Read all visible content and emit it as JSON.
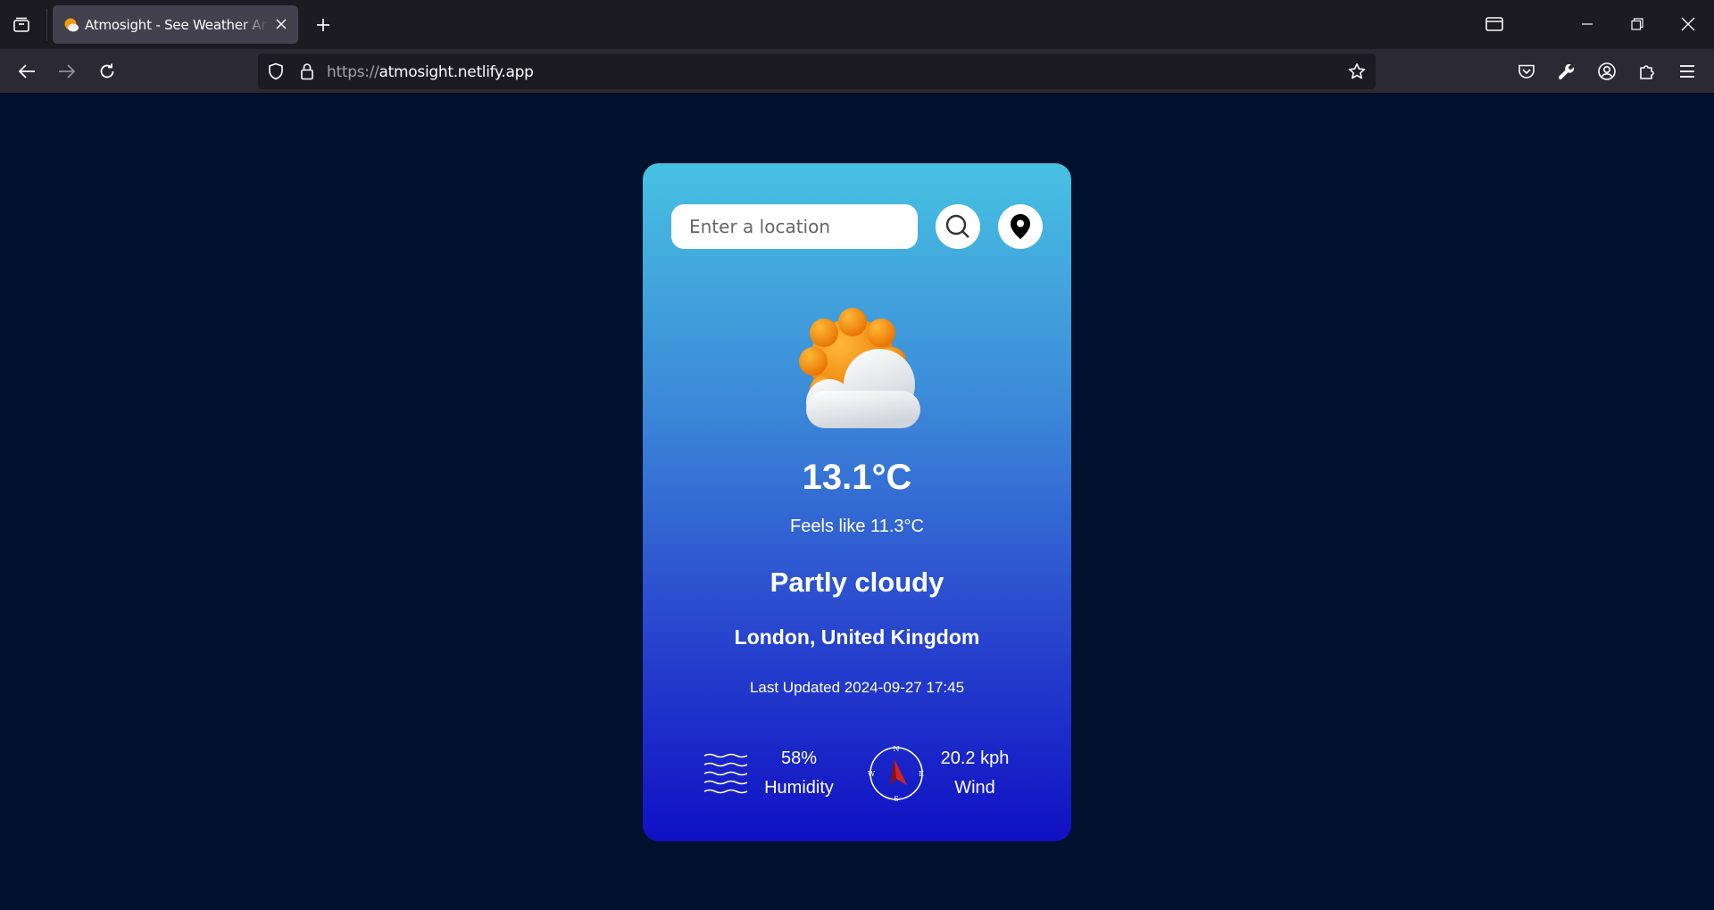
{
  "browser": {
    "tab_title": "Atmosight - See Weather Around the World",
    "url_scheme": "https://",
    "url_host": "atmosight.netlify.app"
  },
  "search": {
    "placeholder": "Enter a location"
  },
  "weather": {
    "temperature": "13.1°C",
    "feels_like": "Feels like 11.3°C",
    "condition": "Partly cloudy",
    "location": "London, United Kingdom",
    "last_updated": "Last Updated 2024-09-27 17:45",
    "icon": "partly-cloudy-icon"
  },
  "stats": {
    "humidity_value": "58%",
    "humidity_label": "Humidity",
    "wind_value": "20.2 kph",
    "wind_label": "Wind",
    "compass": {
      "n": "N",
      "e": "E",
      "s": "S",
      "w": "W"
    }
  },
  "colors": {
    "page_background": "#00112e",
    "card_gradient_top": "#47c1e2",
    "card_gradient_bottom": "#1010c4"
  }
}
